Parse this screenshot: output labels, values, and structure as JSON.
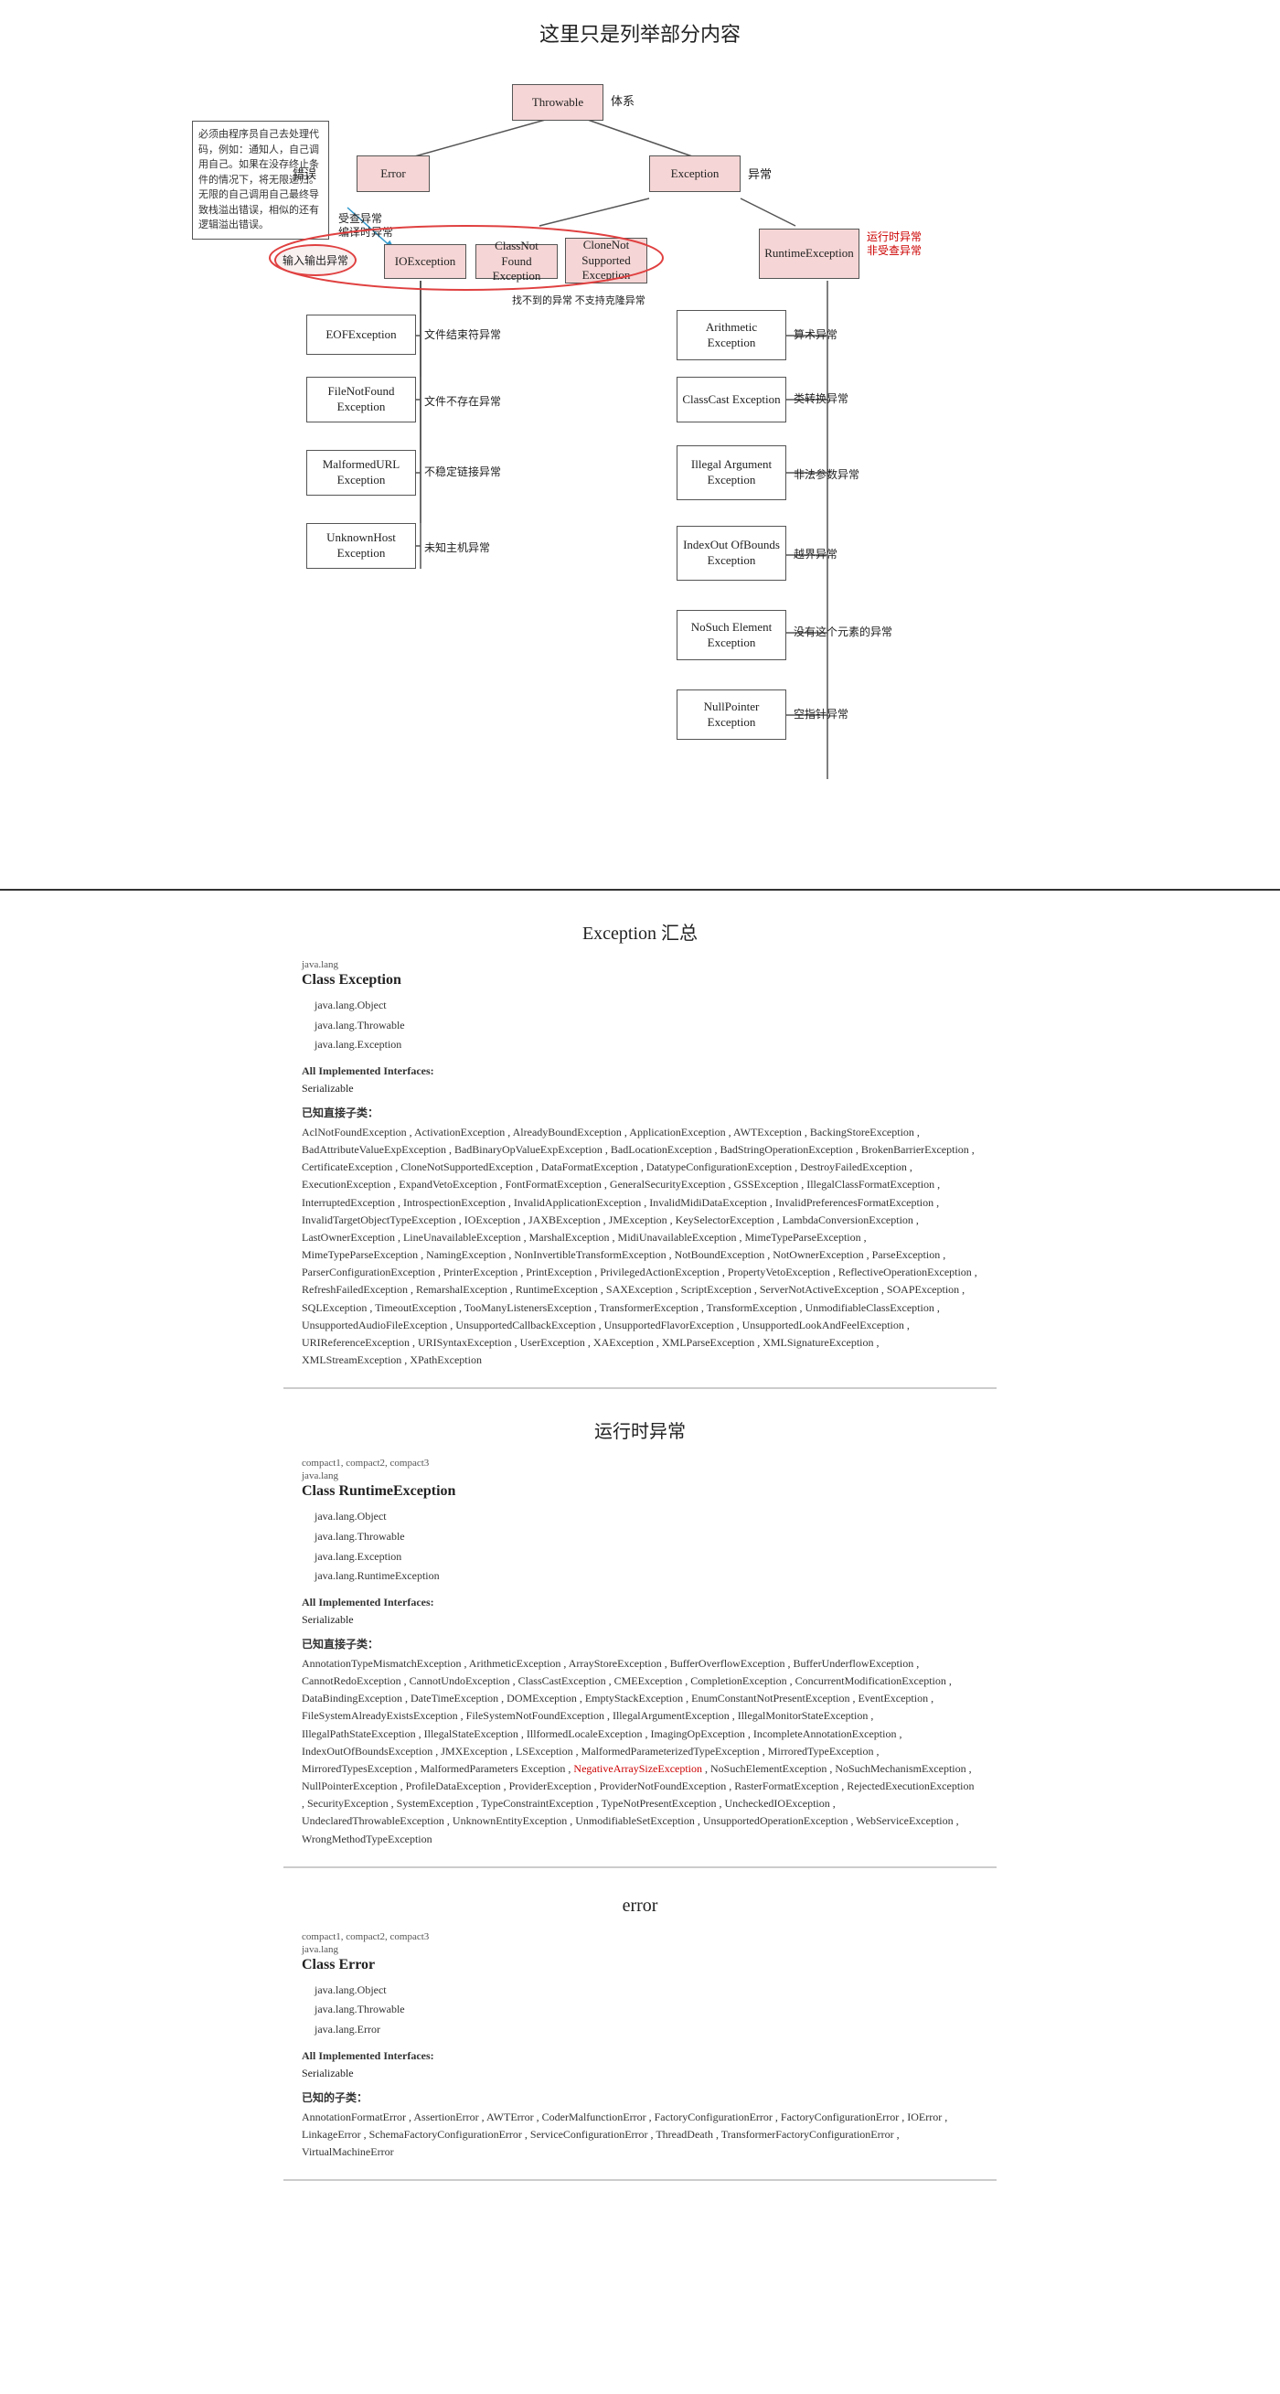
{
  "diagram": {
    "title": "这里只是列举部分内容",
    "annotation": {
      "text": "必须由程序员自己去处理代码，例如：通知人，自己调用自己。如果在没存终止条件的情况下，将无限递归。无限的自己调用自己最终导致栈溢出错误，相似的还有逻辑溢出错误。"
    },
    "labels": {
      "cuowu": "错误",
      "yichang": "异常",
      "tishang": "体系",
      "bianyishiyichang": "编译时异常",
      "shoujia": "受查异常",
      "yunxingshiyichang": "运行时异常",
      "feishouchayichang": "非受查异常",
      "zhaobudao": "找不到的异常 不支持克隆异常",
      "wenjianjiesufu": "文件结束符异常",
      "wenjianbucu": "文件不存在异常",
      "budinglianjie": "不稳定链接异常",
      "weizhi": "未知主机异常",
      "suanshuyichang": "算术异常",
      "leixinzhuanhuan": "类转换异常",
      "feifacanshu": "非法参数异常",
      "yuejie": "越界异常",
      "meiyou": "没有这个元素的异常",
      "zhongjie": "空指针异常"
    },
    "boxes": {
      "throwable": "Throwable",
      "error": "Error",
      "exception": "Exception",
      "ioexception": "IOException",
      "classnotfound": "ClassNot Found Exception",
      "clonenot": "CloneNot Supported Exception",
      "runtime": "RuntimeException",
      "eofexception": "EOFException",
      "filenotfound": "FileNotFound Exception",
      "malformedurl": "MalformedURL Exception",
      "unknownhost": "UnknownHost Exception",
      "arithmetic": "Arithmetic Exception",
      "classcast": "ClassCast Exception",
      "illegalarg": "Illegal Argument Exception",
      "indexout": "IndexOut OfBounds Exception",
      "nosuch": "NoSuch Element Exception",
      "nullpointer": "NullPointer Exception",
      "inputoutput": "输入输出异常"
    }
  },
  "exception_summary": {
    "section_title": "Exception 汇总",
    "package_label": "java.lang",
    "class_title": "Class Exception",
    "hierarchy": [
      "java.lang.Object",
      "java.lang.Throwable",
      "java.lang.Exception"
    ],
    "all_implemented_interfaces_label": "All Implemented Interfaces:",
    "implemented_interfaces": "Serializable",
    "known_subclasses_label": "已知直接子类：",
    "known_subclasses": "AclNotFoundException , ActivationException , AlreadyBoundException , ApplicationException , AWTException , BackingStoreException , BadAttributeValueExpException , BadBinaryOpValueExpException , BadLocationException , BadStringOperationException , BrokenBarrierException , CertificateException , CloneNotSupportedException , DataFormatException , DatatypeConfigurationException , DestroyFailedException , ExecutionException , ExpandVetoException , FontFormatException , GeneralSecurityException , GSSException , IllegalClassFormatException , InterruptedException , IntrospectionException , InvalidApplicationException , InvalidMidiDataException , InvalidPreferencesFormatException , InvalidTargetObjectTypeException , IOException , JAXBException , JMException , KeySelectorException , LambdaConversionException , LastOwnerException , LineUnavailableException , MarshalException , MidiUnavailableException , MimeTypeParseException , MimeTypeParseException , NamingException , NonInvertibleTransformException , NotBoundException , NotOwnerException , ParseException , ParserConfigurationException , PrinterException , PrintException , PrivilegedActionException , PropertyVetoException , ReflectiveOperationException , RefreshFailedException , RemarshalException , RuntimeException , SAXException , ScriptException , ServerNotActiveException , SOAPException , SQLException , TimeoutException , TooManyListenersException , TransformerException , TransformException , UnmodifiableClassException , UnsupportedAudioFileException , UnsupportedCallbackException , UnsupportedFlavorException , UnsupportedLookAndFeelException , URIReferenceException , URISyntaxException , UserException , XAException , XMLParseException , XMLSignatureException , XMLStreamException , XPathException"
  },
  "runtime_exception": {
    "section_title": "运行时异常",
    "package_label": "compact1, compact2, compact3",
    "package_lang": "java.lang",
    "class_title": "Class RuntimeException",
    "hierarchy": [
      "java.lang.Object",
      "java.lang.Throwable",
      "java.lang.Exception",
      "java.lang.RuntimeException"
    ],
    "all_implemented_interfaces_label": "All Implemented Interfaces:",
    "implemented_interfaces": "Serializable",
    "known_subclasses_label": "已知直接子类：",
    "known_subclasses_normal": "AnnotationTypeMismatchException , ArithmeticException , ArrayStoreException , BufferOverflowException , BufferUnderflowException , CannotRedoException , CannotUndoException , ClassCastException , CMEException , CompletionException , ConcurrentModificationException , DataBindingException , DateTimeException , DOMException , EmptyStackException , EnumConstantNotPresentException , EventException , FileSystemAlreadyExistsException , FileSystemNotFoundException , IllegalArgumentException , IllegalMonitorStateException , IllegalPathStateException , IllegalStateException , IllformedLocaleException , ImagingOpException , IncompleteAnnotationException , IndexOutOfBoundsException , JMXException , LSException , MalformedParameterizedTypeException , MirroredTypeException , MirroredTypesException , MalformedParameters Exception , ",
    "known_subclasses_red": "NegativeArraySizeException",
    "known_subclasses_after": " , NoSuchElementException , NoSuchMechanismException , NullPointerException , ProfileDataException , ProviderException , ProviderNotFoundException , RasterFormatException , RejectedExecutionException , SecurityException , SystemException , TypeConstraintException , TypeNotPresentException , UncheckedIOException , UndeclaredThrowableException , UnknownEntityException , UnmodifiableSetException , UnsupportedOperationException , WebServiceException , WrongMethodTypeException"
  },
  "error_section": {
    "section_title": "error",
    "package_label": "compact1, compact2, compact3",
    "package_lang": "java.lang",
    "class_title": "Class Error",
    "hierarchy": [
      "java.lang.Object",
      "java.lang.Throwable",
      "java.lang.Error"
    ],
    "all_implemented_interfaces_label": "All Implemented Interfaces:",
    "implemented_interfaces": "Serializable",
    "known_subclasses_label": "已知的子类：",
    "known_subclasses": "AnnotationFormatError , AssertionError , AWTError , CoderMalfunctionError , FactoryConfigurationError , FactoryConfigurationError , IOError , LinkageError , SchemaFactoryConfigurationError , ServiceConfigurationError , ThreadDeath , TransformerFactoryConfigurationError , VirtualMachineError"
  }
}
